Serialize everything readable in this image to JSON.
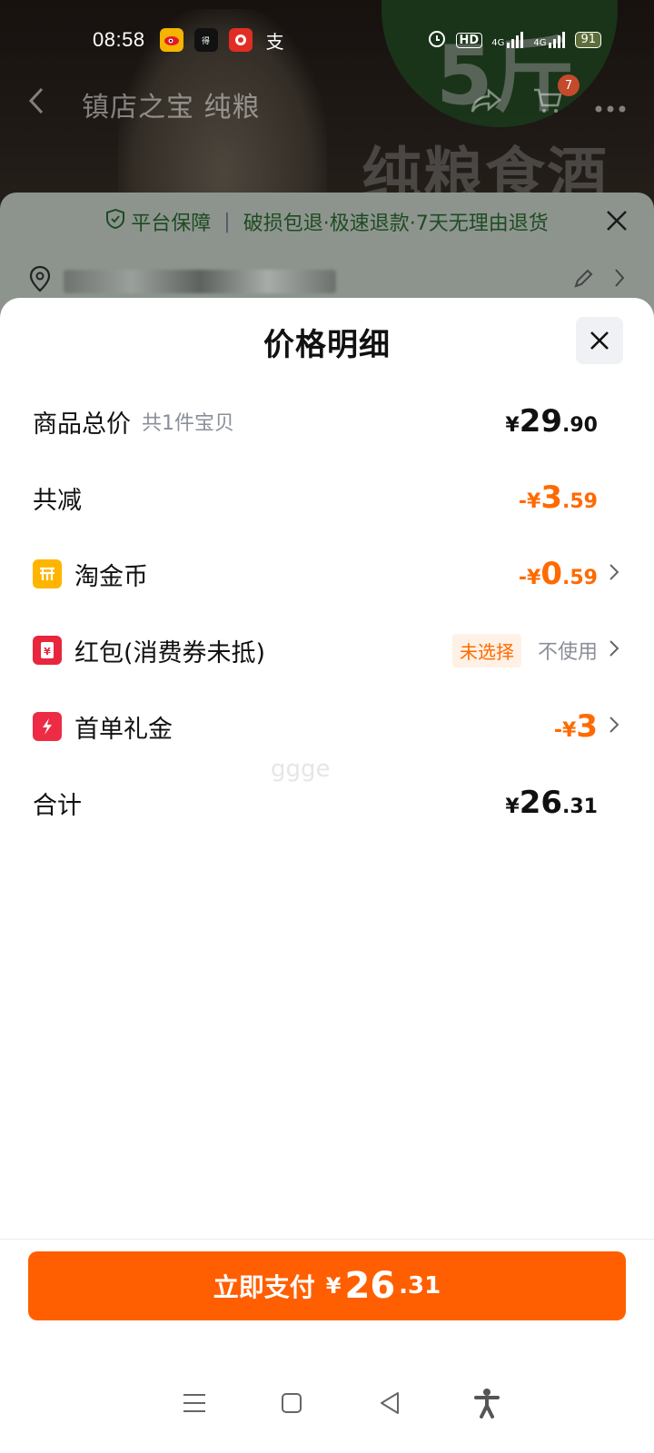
{
  "status_bar": {
    "time": "08:58",
    "app_icons": [
      "weibo-icon",
      "dewu-icon",
      "pdd-icon",
      "alipay-icon"
    ],
    "alipay_char": "支",
    "hd_label": "HD",
    "network1": "4G",
    "network2": "4G",
    "battery": "91"
  },
  "background": {
    "nav_title": "镇店之宝 纯粮",
    "cart_count": "7",
    "product_overlay_text": "纯粮食酒",
    "badge_text": "5斤"
  },
  "order_card": {
    "guarantee_prefix": "平台保障",
    "guarantee_text": "破损包退·极速退款·7天无理由退货"
  },
  "sheet": {
    "title": "价格明细",
    "rows": {
      "total": {
        "label": "商品总价",
        "sub": "共1件宝贝",
        "cur": "¥",
        "int": "29",
        "dec": ".90"
      },
      "reduce": {
        "label": "共减",
        "cur": "-¥",
        "int": "3",
        "dec": ".59"
      },
      "coin": {
        "label": "淘金币",
        "cur": "-¥",
        "int": "0",
        "dec": ".59"
      },
      "hongbao": {
        "label": "红包(消费券未抵)",
        "tag": "未选择",
        "value": "不使用"
      },
      "gift": {
        "label": "首单礼金",
        "cur": "-¥",
        "int": "3",
        "dec": ""
      },
      "sum": {
        "label": "合计",
        "cur": "¥",
        "int": "26",
        "dec": ".31"
      }
    },
    "watermark": "ggge",
    "pay_button": {
      "label": "立即支付",
      "cur": "¥",
      "int": "26",
      "dec": ".31"
    }
  },
  "colors": {
    "accent_orange": "#ff6a00",
    "pay_button": "#ff5f00",
    "coin_icon": "#ffb400",
    "hongbao_icon": "#e8263e",
    "gift_icon": "#ee2b45"
  }
}
